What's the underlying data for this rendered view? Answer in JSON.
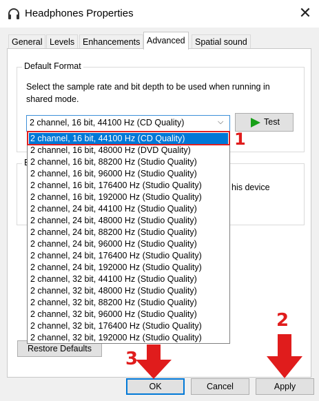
{
  "window": {
    "title": "Headphones Properties",
    "icon": "headphones-icon",
    "close_glyph": "✕"
  },
  "tabs": [
    {
      "label": "General",
      "active": false
    },
    {
      "label": "Levels",
      "active": false
    },
    {
      "label": "Enhancements",
      "active": false
    },
    {
      "label": "Advanced",
      "active": true
    },
    {
      "label": "Spatial sound",
      "active": false
    }
  ],
  "default_format": {
    "group_label": "Default Format",
    "description": "Select the sample rate and bit depth to be used when running in shared mode.",
    "selected_value": "2 channel, 16 bit, 44100 Hz (CD Quality)",
    "test_button": "Test"
  },
  "exclusive_mode": {
    "group_label_visible": "E",
    "partial_text": "his device"
  },
  "dropdown_options": [
    "2 channel, 16 bit, 44100 Hz (CD Quality)",
    "2 channel, 16 bit, 48000 Hz (DVD Quality)",
    "2 channel, 16 bit, 88200 Hz (Studio Quality)",
    "2 channel, 16 bit, 96000 Hz (Studio Quality)",
    "2 channel, 16 bit, 176400 Hz (Studio Quality)",
    "2 channel, 16 bit, 192000 Hz (Studio Quality)",
    "2 channel, 24 bit, 44100 Hz (Studio Quality)",
    "2 channel, 24 bit, 48000 Hz (Studio Quality)",
    "2 channel, 24 bit, 88200 Hz (Studio Quality)",
    "2 channel, 24 bit, 96000 Hz (Studio Quality)",
    "2 channel, 24 bit, 176400 Hz (Studio Quality)",
    "2 channel, 24 bit, 192000 Hz (Studio Quality)",
    "2 channel, 32 bit, 44100 Hz (Studio Quality)",
    "2 channel, 32 bit, 48000 Hz (Studio Quality)",
    "2 channel, 32 bit, 88200 Hz (Studio Quality)",
    "2 channel, 32 bit, 96000 Hz (Studio Quality)",
    "2 channel, 32 bit, 176400 Hz (Studio Quality)",
    "2 channel, 32 bit, 192000 Hz (Studio Quality)"
  ],
  "selected_index": 0,
  "buttons": {
    "restore": "Restore Defaults",
    "ok": "OK",
    "cancel": "Cancel",
    "apply": "Apply"
  },
  "annotations": {
    "step1": "1",
    "step2": "2",
    "step3": "3",
    "color": "#e01c1c"
  },
  "colors": {
    "selection": "#0078d7",
    "play_icon": "#18a018"
  }
}
